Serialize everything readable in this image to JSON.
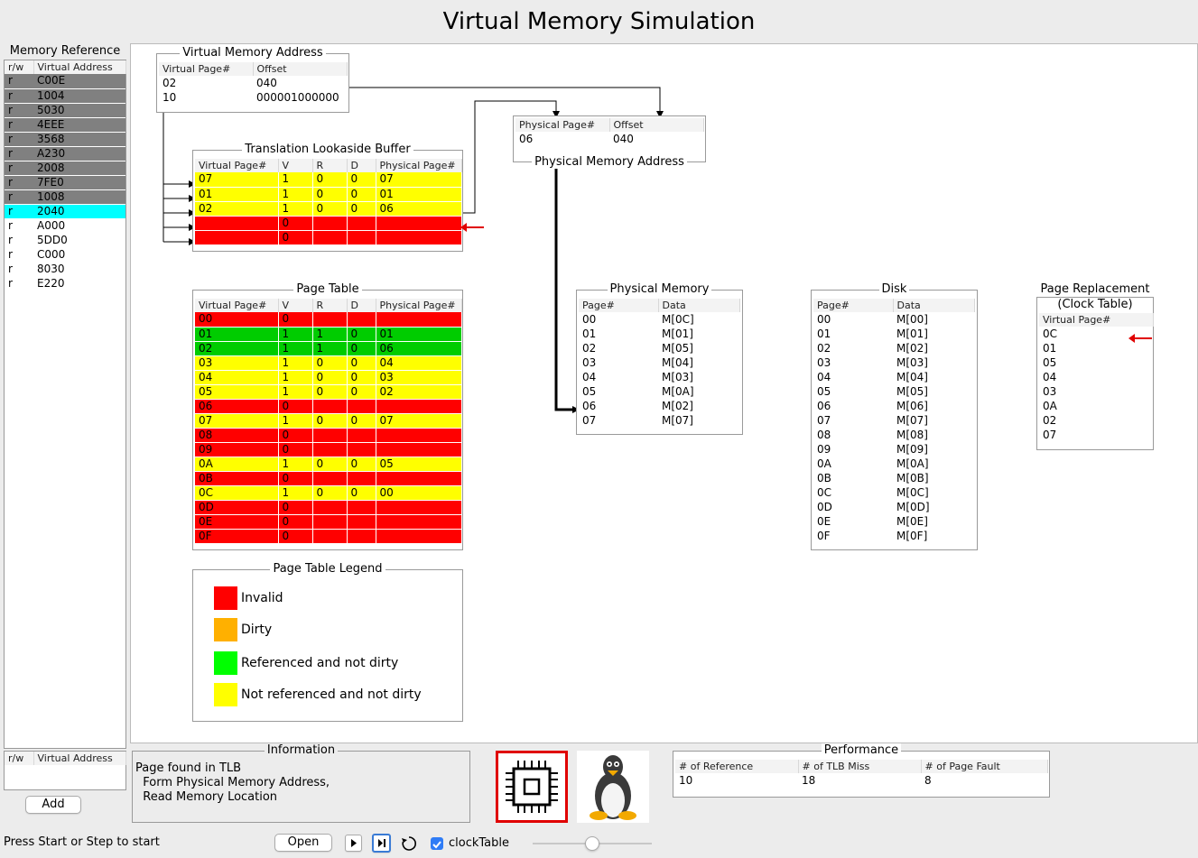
{
  "app": {
    "title": "Virtual Memory Simulation"
  },
  "memory_reference": {
    "title": "Memory Reference",
    "headers": [
      "r/w",
      "Virtual Address"
    ],
    "rows": [
      {
        "rw": "r",
        "addr": "C00E",
        "state": "gray"
      },
      {
        "rw": "r",
        "addr": "1004",
        "state": "gray"
      },
      {
        "rw": "r",
        "addr": "5030",
        "state": "gray"
      },
      {
        "rw": "r",
        "addr": "4EEE",
        "state": "gray"
      },
      {
        "rw": "r",
        "addr": "3568",
        "state": "gray"
      },
      {
        "rw": "r",
        "addr": "A230",
        "state": "gray"
      },
      {
        "rw": "r",
        "addr": "2008",
        "state": "gray"
      },
      {
        "rw": "r",
        "addr": "7FE0",
        "state": "gray"
      },
      {
        "rw": "r",
        "addr": "1008",
        "state": "gray"
      },
      {
        "rw": "r",
        "addr": "2040",
        "state": "cyan"
      },
      {
        "rw": "r",
        "addr": "A000",
        "state": "none"
      },
      {
        "rw": "r",
        "addr": "5DD0",
        "state": "none"
      },
      {
        "rw": "r",
        "addr": "C000",
        "state": "none"
      },
      {
        "rw": "r",
        "addr": "8030",
        "state": "none"
      },
      {
        "rw": "r",
        "addr": "E220",
        "state": "none"
      }
    ],
    "input_headers": [
      "r/w",
      "Virtual Address"
    ],
    "add_label": "Add"
  },
  "vma": {
    "title": "Virtual Memory Address",
    "headers": [
      "Virtual Page#",
      "Offset"
    ],
    "rows": [
      [
        "02",
        "040"
      ],
      [
        "10",
        "000001000000"
      ]
    ]
  },
  "pma": {
    "title": "Physical Memory Address",
    "headers": [
      "Physical Page#",
      "Offset"
    ],
    "rows": [
      [
        "06",
        "040"
      ]
    ]
  },
  "tlb": {
    "title": "Translation Lookaside Buffer",
    "headers": [
      "Virtual Page#",
      "V",
      "R",
      "D",
      "Physical Page#"
    ],
    "rows": [
      {
        "cells": [
          "07",
          "1",
          "0",
          "0",
          "07"
        ],
        "color": "yellow"
      },
      {
        "cells": [
          "01",
          "1",
          "0",
          "0",
          "01"
        ],
        "color": "yellow"
      },
      {
        "cells": [
          "02",
          "1",
          "0",
          "0",
          "06"
        ],
        "color": "yellow"
      },
      {
        "cells": [
          "",
          "0",
          "",
          "",
          ""
        ],
        "color": "red"
      },
      {
        "cells": [
          "",
          "0",
          "",
          "",
          ""
        ],
        "color": "red"
      }
    ]
  },
  "page_table": {
    "title": "Page Table",
    "headers": [
      "Virtual Page#",
      "V",
      "R",
      "D",
      "Physical Page#"
    ],
    "rows": [
      {
        "cells": [
          "00",
          "0",
          "",
          "",
          ""
        ],
        "color": "red"
      },
      {
        "cells": [
          "01",
          "1",
          "1",
          "0",
          "01"
        ],
        "color": "green"
      },
      {
        "cells": [
          "02",
          "1",
          "1",
          "0",
          "06"
        ],
        "color": "green"
      },
      {
        "cells": [
          "03",
          "1",
          "0",
          "0",
          "04"
        ],
        "color": "yellow"
      },
      {
        "cells": [
          "04",
          "1",
          "0",
          "0",
          "03"
        ],
        "color": "yellow"
      },
      {
        "cells": [
          "05",
          "1",
          "0",
          "0",
          "02"
        ],
        "color": "yellow"
      },
      {
        "cells": [
          "06",
          "0",
          "",
          "",
          ""
        ],
        "color": "red"
      },
      {
        "cells": [
          "07",
          "1",
          "0",
          "0",
          "07"
        ],
        "color": "yellow"
      },
      {
        "cells": [
          "08",
          "0",
          "",
          "",
          ""
        ],
        "color": "red"
      },
      {
        "cells": [
          "09",
          "0",
          "",
          "",
          ""
        ],
        "color": "red"
      },
      {
        "cells": [
          "0A",
          "1",
          "0",
          "0",
          "05"
        ],
        "color": "yellow"
      },
      {
        "cells": [
          "0B",
          "0",
          "",
          "",
          ""
        ],
        "color": "red"
      },
      {
        "cells": [
          "0C",
          "1",
          "0",
          "0",
          "00"
        ],
        "color": "yellow"
      },
      {
        "cells": [
          "0D",
          "0",
          "",
          "",
          ""
        ],
        "color": "red"
      },
      {
        "cells": [
          "0E",
          "0",
          "",
          "",
          ""
        ],
        "color": "red"
      },
      {
        "cells": [
          "0F",
          "0",
          "",
          "",
          ""
        ],
        "color": "red"
      }
    ]
  },
  "legend": {
    "title": "Page Table Legend",
    "items": [
      {
        "label": "Invalid",
        "color": "#ff0000"
      },
      {
        "label": "Dirty",
        "color": "#ffb000"
      },
      {
        "label": "Referenced and not dirty",
        "color": "#00ff00"
      },
      {
        "label": "Not referenced and not dirty",
        "color": "#ffff00"
      }
    ]
  },
  "physical_memory": {
    "title": "Physical Memory",
    "headers": [
      "Page#",
      "Data"
    ],
    "rows": [
      [
        "00",
        "M[0C]"
      ],
      [
        "01",
        "M[01]"
      ],
      [
        "02",
        "M[05]"
      ],
      [
        "03",
        "M[04]"
      ],
      [
        "04",
        "M[03]"
      ],
      [
        "05",
        "M[0A]"
      ],
      [
        "06",
        "M[02]"
      ],
      [
        "07",
        "M[07]"
      ]
    ]
  },
  "disk": {
    "title": "Disk",
    "headers": [
      "Page#",
      "Data"
    ],
    "rows": [
      [
        "00",
        "M[00]"
      ],
      [
        "01",
        "M[01]"
      ],
      [
        "02",
        "M[02]"
      ],
      [
        "03",
        "M[03]"
      ],
      [
        "04",
        "M[04]"
      ],
      [
        "05",
        "M[05]"
      ],
      [
        "06",
        "M[06]"
      ],
      [
        "07",
        "M[07]"
      ],
      [
        "08",
        "M[08]"
      ],
      [
        "09",
        "M[09]"
      ],
      [
        "0A",
        "M[0A]"
      ],
      [
        "0B",
        "M[0B]"
      ],
      [
        "0C",
        "M[0C]"
      ],
      [
        "0D",
        "M[0D]"
      ],
      [
        "0E",
        "M[0E]"
      ],
      [
        "0F",
        "M[0F]"
      ]
    ]
  },
  "page_replacement": {
    "title_line1": "Page Replacement",
    "title_line2": "(Clock Table)",
    "headers": [
      "Virtual Page#"
    ],
    "rows": [
      "0C",
      "01",
      "05",
      "04",
      "03",
      "0A",
      "02",
      "07"
    ]
  },
  "information": {
    "title": "Information",
    "text": "Page found in TLB\n  Form Physical Memory Address,\n  Read Memory Location"
  },
  "performance": {
    "title": "Performance",
    "headers": [
      "# of Reference",
      "# of TLB Miss",
      "# of Page Fault"
    ],
    "values": [
      "10",
      "18",
      "8"
    ]
  },
  "bottom": {
    "status": "Press Start or Step to start",
    "open_label": "Open",
    "clock_label": "clockTable",
    "clock_checked": true,
    "speed": 0.5
  },
  "icons": [
    "cpu-icon",
    "linux-penguin-icon",
    "play-icon",
    "step-icon",
    "reset-icon"
  ]
}
